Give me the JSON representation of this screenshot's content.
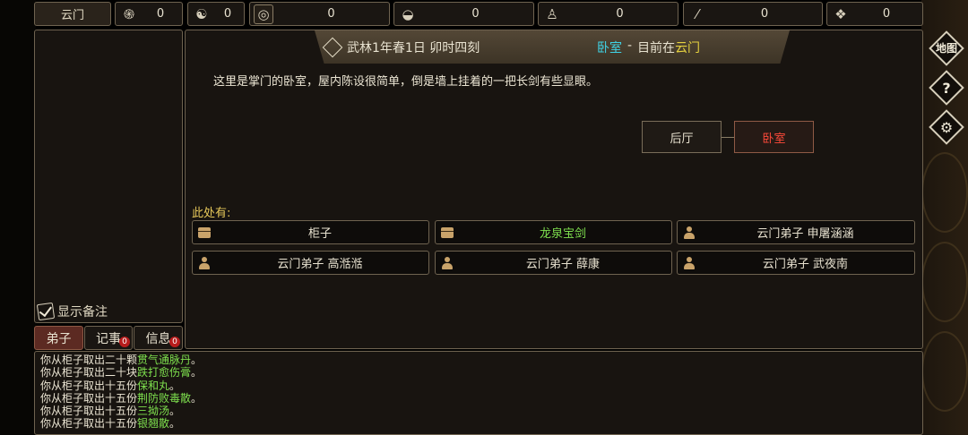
{
  "top_bar": {
    "sect_name": "云门",
    "resources": [
      {
        "icon": "spiral-coin-icon",
        "value": "0"
      },
      {
        "icon": "yin-yang-icon",
        "value": "0"
      },
      {
        "icon": "copper-coin-icon",
        "value": "0"
      },
      {
        "icon": "food-bowl-icon",
        "value": "0"
      },
      {
        "icon": "gourd-icon",
        "value": "0"
      },
      {
        "icon": "scroll-icon",
        "value": "0"
      },
      {
        "icon": "ore-icon",
        "value": "0"
      }
    ]
  },
  "left_panel": {
    "show_notes_label": "显示备注",
    "tabs": [
      {
        "label": "弟子",
        "badge": ""
      },
      {
        "label": "记事",
        "badge": "0"
      },
      {
        "label": "信息",
        "badge": "0"
      }
    ]
  },
  "header": {
    "date": "武林1年春1日 卯时四刻",
    "room": "卧室",
    "separator": "-",
    "location_prefix": "目前在",
    "location": "云门"
  },
  "description": "这里是掌门的卧室，屋内陈设很简单，倒是墙上挂着的一把长剑有些显眼。",
  "map": {
    "rooms": [
      {
        "name": "后厅",
        "current": false
      },
      {
        "name": "卧室",
        "current": true
      }
    ]
  },
  "here": {
    "label": "此处有:",
    "items": [
      {
        "name": "柜子",
        "icon": "chest-icon",
        "highlight": false
      },
      {
        "name": "龙泉宝剑",
        "icon": "treasure-chest-icon",
        "highlight": true
      },
      {
        "name": "云门弟子 申屠涵涵",
        "icon": "person-icon",
        "highlight": false
      },
      {
        "name": "云门弟子 高湉湉",
        "icon": "person-icon",
        "highlight": false
      },
      {
        "name": "云门弟子 薛康",
        "icon": "person-icon",
        "highlight": false
      },
      {
        "name": "云门弟子 武夜南",
        "icon": "person-icon",
        "highlight": false
      }
    ]
  },
  "log": [
    {
      "prefix": "你从柜子取出二十颗",
      "item": "贯气通脉丹",
      "suffix": "。"
    },
    {
      "prefix": "你从柜子取出二十块",
      "item": "跌打愈伤膏",
      "suffix": "。"
    },
    {
      "prefix": "你从柜子取出十五份",
      "item": "保和丸",
      "suffix": "。"
    },
    {
      "prefix": "你从柜子取出十五份",
      "item": "荆防败毒散",
      "suffix": "。"
    },
    {
      "prefix": "你从柜子取出十五份",
      "item": "三拗汤",
      "suffix": "。"
    },
    {
      "prefix": "你从柜子取出十五份",
      "item": "银翘散",
      "suffix": "。"
    }
  ],
  "right_menu": {
    "map_label": "地图",
    "help_glyph": "?",
    "settings_glyph": "⚙"
  },
  "colors": {
    "cyan": "#3fd3e6",
    "yellow": "#e6d23f",
    "green": "#7ee04e",
    "current_room_red": "#ff4a3a"
  }
}
